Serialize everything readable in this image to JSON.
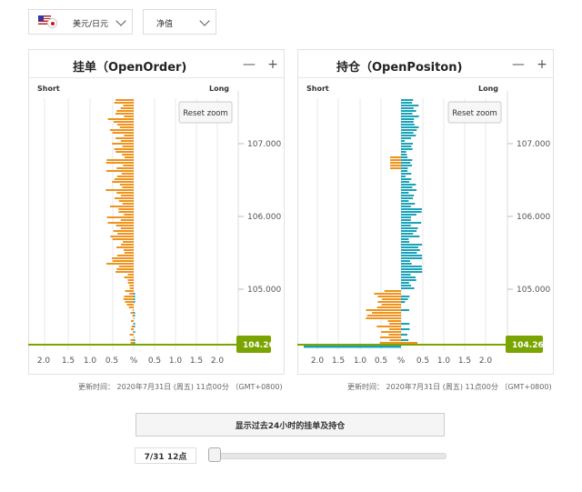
{
  "pair_select": {
    "label": "美元/日元"
  },
  "mode_select": {
    "label": "净值"
  },
  "order_panel": {
    "title": "挂单（OpenOrder)",
    "short": "Short",
    "long": "Long",
    "reset": "Reset zoom",
    "minus": "—",
    "plus": "+",
    "update": "更新时间： 2020年7月31日 (周五) 11点00分 （GMT+0800)"
  },
  "position_panel": {
    "title": "持仓（OpenPositon)",
    "short": "Short",
    "long": "Long",
    "reset": "Reset zoom",
    "minus": "—",
    "plus": "+",
    "update": "更新时间： 2020年7月31日 (周五) 11点00分 （GMT+0800)"
  },
  "price_ticks": [
    "107.000",
    "106.000",
    "105.000"
  ],
  "current_price": "104.26",
  "x_ticks": [
    "2.0",
    "1.5",
    "1.0",
    "0.5",
    "%",
    "0.5",
    "1.0",
    "1.5",
    "2.0"
  ],
  "colors": {
    "short": "#f0921c",
    "long": "#1aa2b8",
    "price_line": "#7aa500"
  },
  "show_history_button": "显示过去24小时的挂单及持仓",
  "time_label": "7/31 12点",
  "slider": {
    "value": 0
  }
}
